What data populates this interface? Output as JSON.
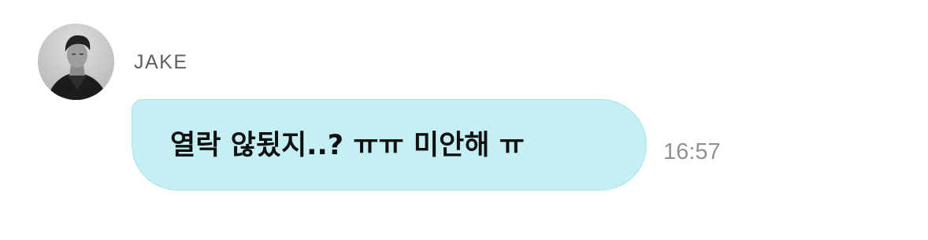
{
  "message": {
    "sender_name": "JAKE",
    "avatar": "profile-photo",
    "text": "열락 않됬지..? ㅠㅠ 미안해 ㅠ",
    "time": "16:57",
    "bubble_color": "#c5eff3",
    "text_color": "#111111",
    "time_color": "#909090",
    "name_color": "#5f5f5f"
  }
}
